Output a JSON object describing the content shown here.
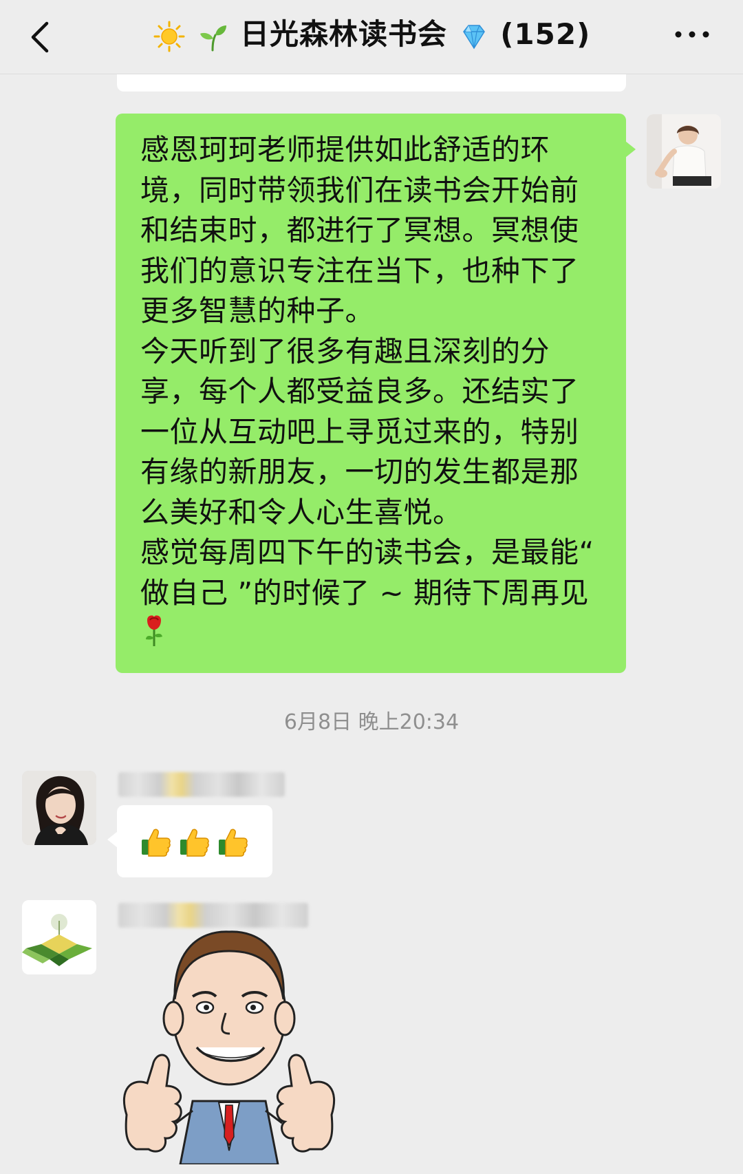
{
  "header": {
    "back_icon": "chevron-left-icon",
    "leading_icons": [
      "sun-icon",
      "seedling-icon"
    ],
    "group_name": "日光森林读书会",
    "badge_icon": "diamond-icon",
    "member_count": "(152)",
    "more_icon": "more-dots-icon"
  },
  "messages": {
    "self": {
      "paragraph_1": "感恩珂珂老师提供如此舒适的环境，同时带领我们在读书会开始前和结束时，都进行了冥想。冥想使我们的意识专注在当下，也种下了更多智慧的种子。",
      "paragraph_2": "今天听到了很多有趣且深刻的分享，每个人都受益良多。还结实了一位从互动吧上寻觅过来的，特别有缘的新朋友，一切的发生都是那么美好和令人心生喜悦。",
      "paragraph_3": "感觉每周四下午的读书会，是最能“ 做自己 ”的时候了 ~ 期待下周再见",
      "trailing_icon": "rose-icon",
      "bubble_color": "#95ec69"
    },
    "timestamp": "6月8日 晚上20:34",
    "member_a": {
      "avatar": "woman-portrait-avatar",
      "reaction_icons": [
        "thumbs-up-icon",
        "thumbs-up-icon",
        "thumbs-up-icon"
      ]
    },
    "member_b": {
      "avatar": "green-field-logo-avatar",
      "sticker": "cartoon-man-thumbs-up-sticker"
    }
  },
  "colors": {
    "background": "#ededed",
    "self_bubble": "#95ec69",
    "other_bubble": "#ffffff",
    "timestamp_text": "#8f8f8f"
  }
}
